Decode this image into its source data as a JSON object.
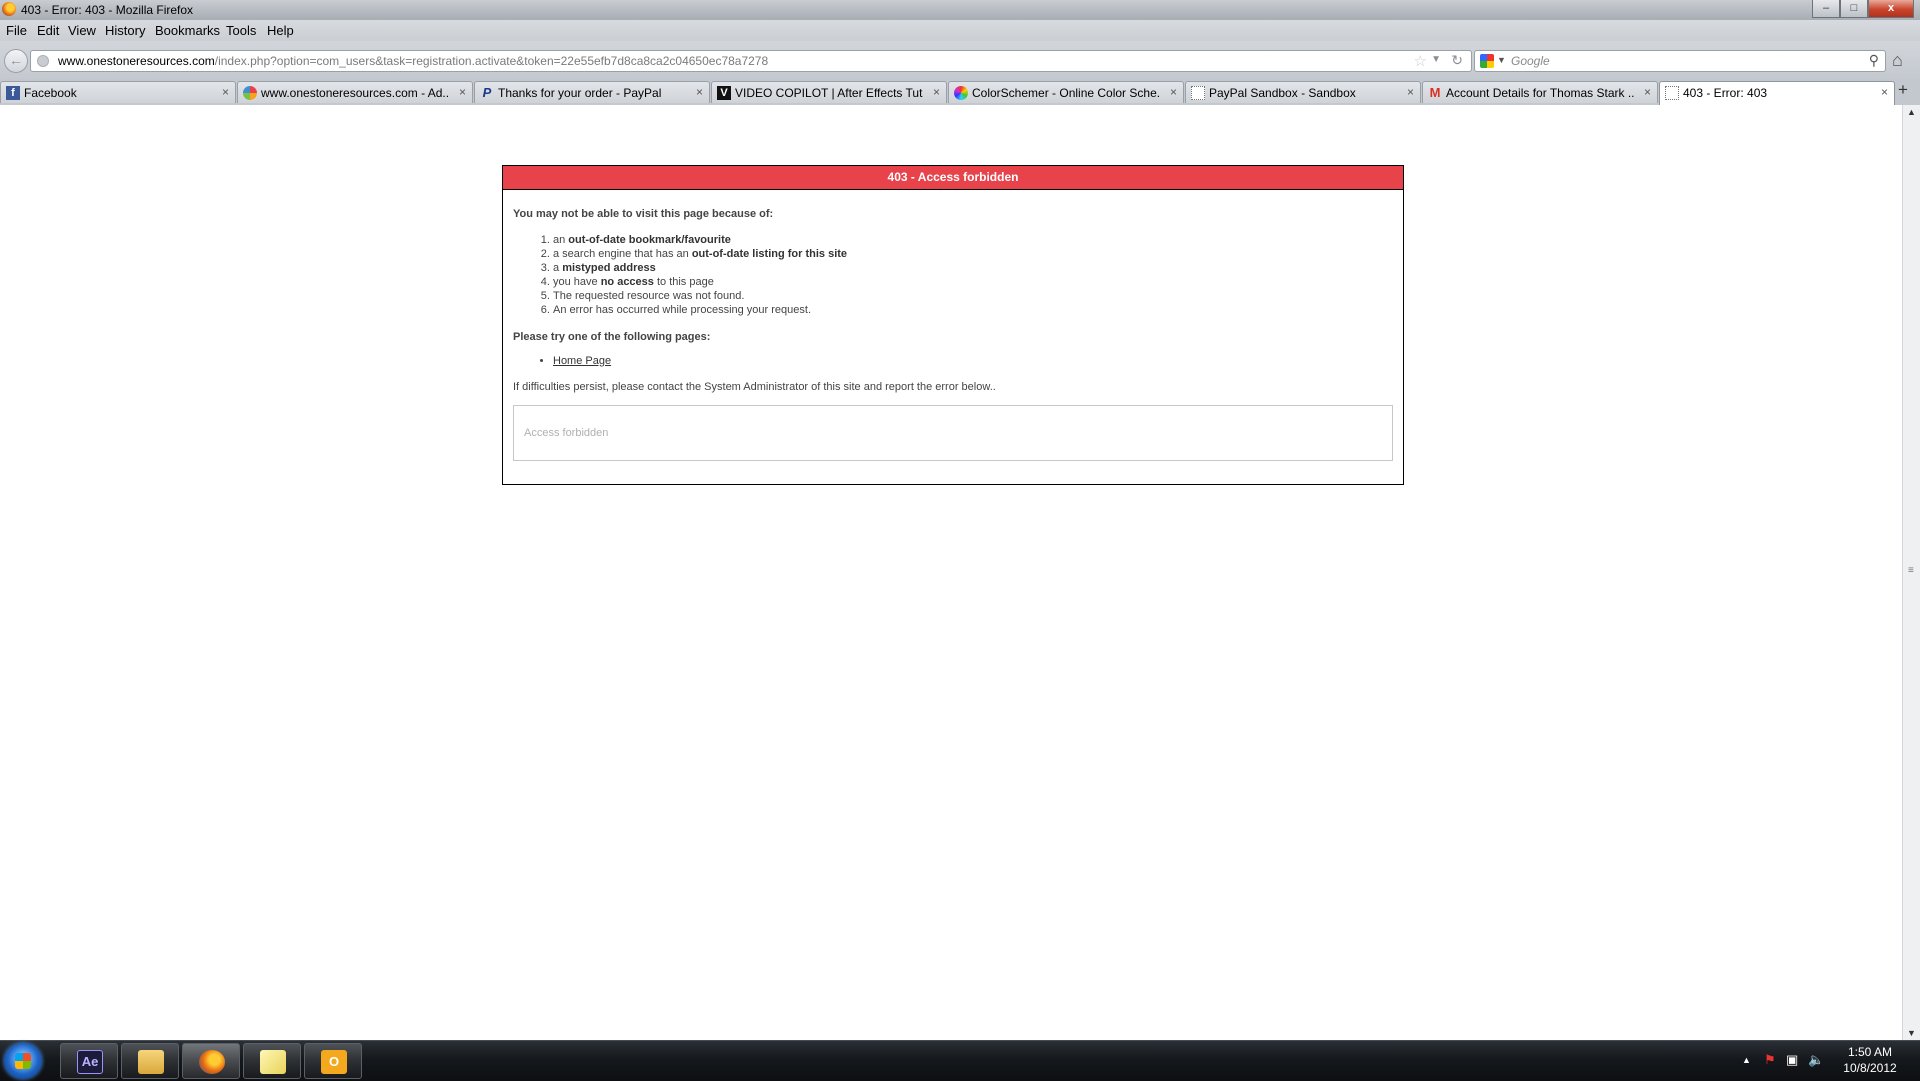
{
  "window": {
    "title": "403 - Error: 403 - Mozilla Firefox"
  },
  "window_buttons": {
    "minimize": "–",
    "maximize": "□",
    "close": "x"
  },
  "menu": {
    "items": [
      "File",
      "Edit",
      "View",
      "History",
      "Bookmarks",
      "Tools",
      "Help"
    ]
  },
  "navbar": {
    "url_domain": "www.onestoneresources.com",
    "url_path": "/index.php?option=com_users&task=registration.activate&token=22e55efb7d8ca8ca2c04650ec78a7278",
    "search_placeholder": "Google",
    "icons": [
      "back-arrow-icon",
      "site-identity-icon",
      "bookmark-star-icon",
      "history-dropdown-icon",
      "reload-icon",
      "google-icon",
      "search-icon",
      "home-icon"
    ]
  },
  "tabs": [
    {
      "label": "Facebook",
      "icon": "facebook-icon",
      "color": "#3b5998",
      "active": false
    },
    {
      "label": "www.onestoneresources.com - Ad...",
      "icon": "joomla-icon",
      "color": "#e8434b",
      "active": false
    },
    {
      "label": "Thanks for your order - PayPal",
      "icon": "paypal-icon",
      "color": "#1a3a8a",
      "active": false
    },
    {
      "label": "VIDEO COPILOT | After Effects Tut...",
      "icon": "videocopilot-icon",
      "color": "#111111",
      "active": false
    },
    {
      "label": "ColorSchemer - Online Color Sche...",
      "icon": "colorwheel-icon",
      "color": "#cc3333",
      "active": false
    },
    {
      "label": "PayPal Sandbox - Sandbox",
      "icon": "blank-page-icon",
      "color": "#ffffff",
      "active": false
    },
    {
      "label": "Account Details for Thomas Stark ...",
      "icon": "gmail-icon",
      "color": "#d93025",
      "active": false
    },
    {
      "label": "403 - Error: 403",
      "icon": "blank-page-icon",
      "color": "#ffffff",
      "active": true
    }
  ],
  "tab_close_glyph": "×",
  "new_tab_glyph": "+",
  "error_page": {
    "header": "403 - Access forbidden",
    "lead": "You may not be able to visit this page because of:",
    "reasons": [
      {
        "pre": "an ",
        "bold": "out-of-date bookmark/favourite",
        "post": ""
      },
      {
        "pre": "a search engine that has an ",
        "bold": "out-of-date listing for this site",
        "post": ""
      },
      {
        "pre": "a ",
        "bold": "mistyped address",
        "post": ""
      },
      {
        "pre": "you have ",
        "bold": "no access",
        "post": " to this page"
      },
      {
        "pre": "The requested resource was not found.",
        "bold": "",
        "post": ""
      },
      {
        "pre": "An error has occurred while processing your request.",
        "bold": "",
        "post": ""
      }
    ],
    "try_lead": "Please try one of the following pages:",
    "links": [
      "Home Page"
    ],
    "persist": "If difficulties persist, please contact the System Administrator of this site and report the error below..",
    "error_message": "Access forbidden",
    "colors": {
      "header_bg": "#e8434b",
      "header_text": "#ffffff"
    }
  },
  "taskbar": {
    "apps": [
      {
        "name": "after-effects",
        "label": "Ae",
        "active": false
      },
      {
        "name": "explorer",
        "label": "",
        "active": false
      },
      {
        "name": "firefox",
        "label": "",
        "active": true
      },
      {
        "name": "sticky-notes",
        "label": "",
        "active": false
      },
      {
        "name": "outlook",
        "label": "O",
        "active": false
      }
    ],
    "tray_icons": [
      "show-hidden-icons-arrow-icon",
      "action-center-flag-icon",
      "network-icon",
      "volume-icon"
    ],
    "clock_time": "1:50 AM",
    "clock_date": "10/8/2012"
  }
}
